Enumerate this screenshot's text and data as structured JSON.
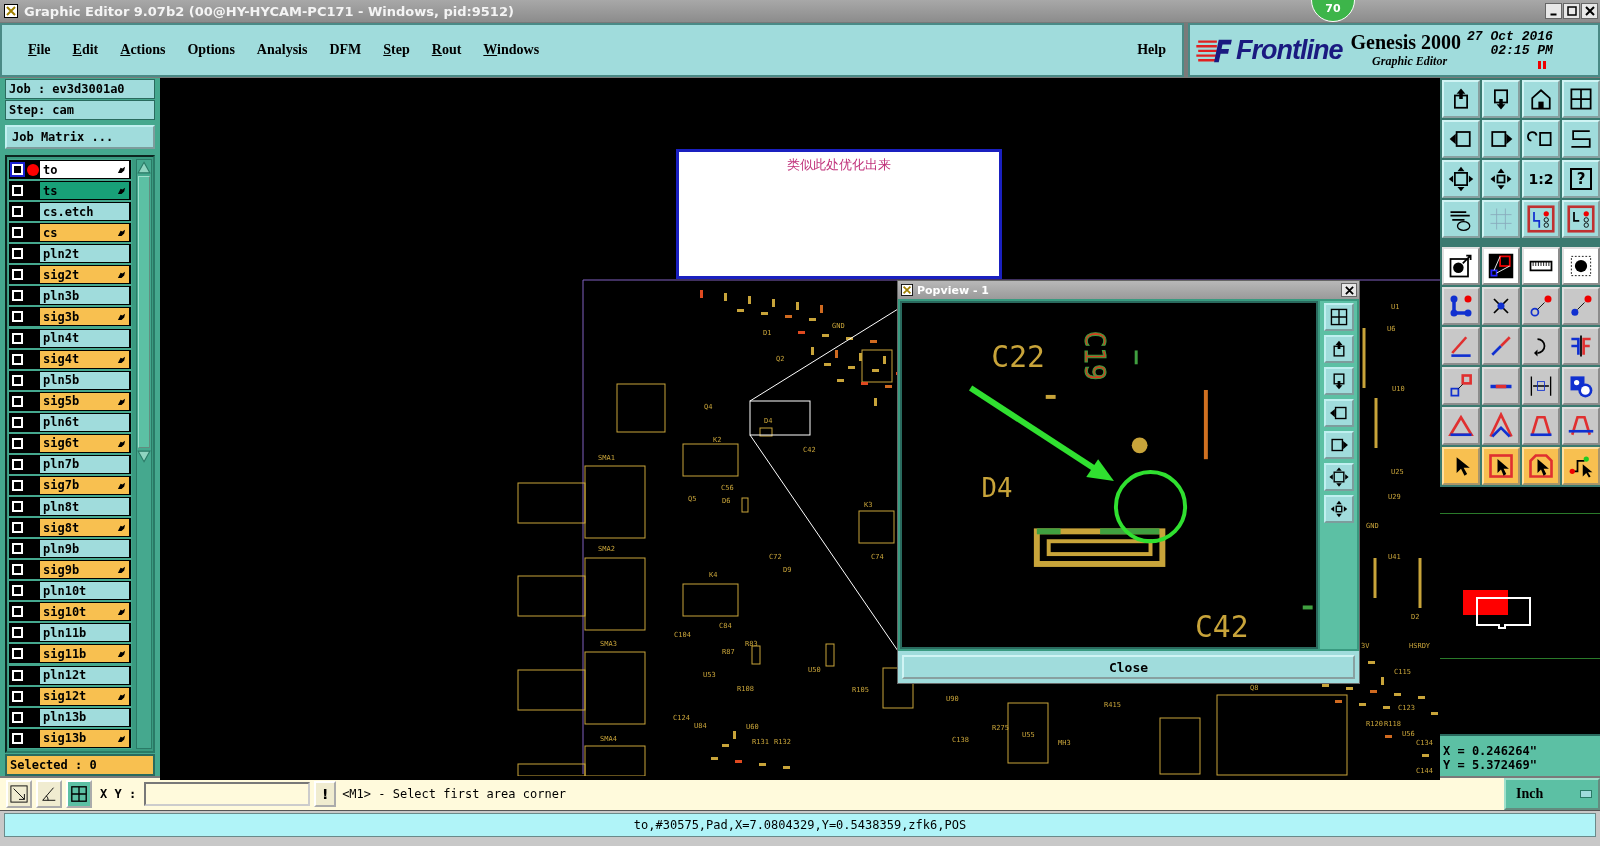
{
  "window": {
    "title": "Graphic Editor 9.07b2 (00@HY-HYCAM-PC171 - Windows, pid:9512)"
  },
  "badge": "70",
  "menu": [
    {
      "label": "File",
      "mnemonic": true
    },
    {
      "label": "Edit",
      "mnemonic": true
    },
    {
      "label": "Actions",
      "mnemonic": true
    },
    {
      "label": "Options",
      "mnemonic": false
    },
    {
      "label": "Analysis",
      "mnemonic": false
    },
    {
      "label": "DFM",
      "mnemonic": false
    },
    {
      "label": "Step",
      "mnemonic": true
    },
    {
      "label": "Rout",
      "mnemonic": true
    },
    {
      "label": "Windows",
      "mnemonic": true
    }
  ],
  "help": "Help",
  "brand": {
    "logo": "Frontline",
    "product": "Genesis 2000",
    "subtitle": "Graphic Editor",
    "date": "27 Oct 2016",
    "time": "02:15 PM"
  },
  "job": {
    "job": "Job : ev3d3001a0",
    "step": "Step: cam",
    "matrix_button": "Job Matrix ...",
    "selected": "Selected : 0"
  },
  "layers": [
    {
      "name": "to",
      "color": "#ffffff",
      "checked": false,
      "work": true,
      "board": true
    },
    {
      "name": "ts",
      "color": "#18a078",
      "checked": false,
      "work": false,
      "board": true
    },
    {
      "name": "cs.etch",
      "color": "#a0dcdc",
      "checked": false,
      "work": false,
      "board": false
    },
    {
      "name": "cs",
      "color": "#f8c050",
      "checked": false,
      "work": false,
      "board": true
    },
    {
      "name": "pln2t",
      "color": "#a0dcdc",
      "checked": false,
      "work": false,
      "board": false
    },
    {
      "name": "sig2t",
      "color": "#f8c050",
      "checked": false,
      "work": false,
      "board": true
    },
    {
      "name": "pln3b",
      "color": "#a0dcdc",
      "checked": false,
      "work": false,
      "board": false
    },
    {
      "name": "sig3b",
      "color": "#f8c050",
      "checked": false,
      "work": false,
      "board": true
    },
    {
      "name": "pln4t",
      "color": "#a0dcdc",
      "checked": false,
      "work": false,
      "board": false
    },
    {
      "name": "sig4t",
      "color": "#f8c050",
      "checked": false,
      "work": false,
      "board": true
    },
    {
      "name": "pln5b",
      "color": "#a0dcdc",
      "checked": false,
      "work": false,
      "board": false
    },
    {
      "name": "sig5b",
      "color": "#f8c050",
      "checked": false,
      "work": false,
      "board": true
    },
    {
      "name": "pln6t",
      "color": "#a0dcdc",
      "checked": false,
      "work": false,
      "board": false
    },
    {
      "name": "sig6t",
      "color": "#f8c050",
      "checked": false,
      "work": false,
      "board": true
    },
    {
      "name": "pln7b",
      "color": "#a0dcdc",
      "checked": false,
      "work": false,
      "board": false
    },
    {
      "name": "sig7b",
      "color": "#f8c050",
      "checked": false,
      "work": false,
      "board": true
    },
    {
      "name": "pln8t",
      "color": "#a0dcdc",
      "checked": false,
      "work": false,
      "board": false
    },
    {
      "name": "sig8t",
      "color": "#f8c050",
      "checked": false,
      "work": false,
      "board": true
    },
    {
      "name": "pln9b",
      "color": "#a0dcdc",
      "checked": false,
      "work": false,
      "board": false
    },
    {
      "name": "sig9b",
      "color": "#f8c050",
      "checked": false,
      "work": false,
      "board": true
    },
    {
      "name": "pln10t",
      "color": "#a0dcdc",
      "checked": false,
      "work": false,
      "board": false
    },
    {
      "name": "sig10t",
      "color": "#f8c050",
      "checked": false,
      "work": false,
      "board": true
    },
    {
      "name": "pln11b",
      "color": "#a0dcdc",
      "checked": false,
      "work": false,
      "board": false
    },
    {
      "name": "sig11b",
      "color": "#f8c050",
      "checked": false,
      "work": false,
      "board": true
    },
    {
      "name": "pln12t",
      "color": "#a0dcdc",
      "checked": false,
      "work": false,
      "board": false
    },
    {
      "name": "sig12t",
      "color": "#f8c050",
      "checked": false,
      "work": false,
      "board": true
    },
    {
      "name": "pln13b",
      "color": "#a0dcdc",
      "checked": false,
      "work": false,
      "board": false
    },
    {
      "name": "sig13b",
      "color": "#f8c050",
      "checked": false,
      "work": false,
      "board": true
    }
  ],
  "toolbar": {
    "ratio": "1:2",
    "help": "?"
  },
  "canvas": {
    "labels": [
      "SMA1",
      "SMA2",
      "SMA3",
      "SMA4",
      "K2",
      "K4",
      "K3",
      "Q4",
      "D1",
      "Q2",
      "GND",
      "D4",
      "C42",
      "Q5",
      "C56",
      "D6",
      "C72",
      "D9",
      "C74",
      "C84",
      "C104",
      "R87",
      "R83",
      "U53",
      "R108",
      "U84",
      "C124",
      "U60",
      "R131",
      "R132",
      "U50",
      "R105",
      "U90",
      "C138",
      "R275",
      "U55",
      "MH3",
      "R415",
      "U1",
      "U6",
      "U10",
      "U25",
      "U29",
      "GND",
      "U41",
      "D2",
      "3V",
      "HSRDY",
      "C115",
      "C123",
      "R120",
      "R118",
      "U56",
      "C134",
      "C144",
      "Q8"
    ]
  },
  "note": {
    "text": "类似此处优化出来"
  },
  "popview": {
    "title": "Popview - 1",
    "labels": [
      "C22",
      "C19",
      "D4",
      "C42"
    ],
    "close": "Close"
  },
  "coords": {
    "x": "X = 0.246264\"",
    "y": "Y = 5.372469\""
  },
  "command": {
    "xy_label": "X Y :",
    "alert": "!",
    "prompt": "<M1> - Select first area corner",
    "units": "Inch"
  },
  "status_bar": "to,#30575,Pad,X=7.0804329,Y=0.5438359,zfk6,POS"
}
